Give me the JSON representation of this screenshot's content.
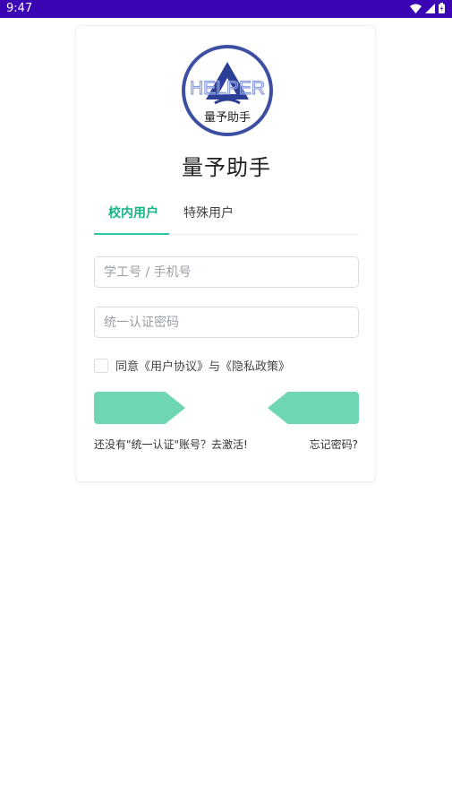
{
  "status_bar": {
    "time": "9:47"
  },
  "app": {
    "title": "量予助手",
    "logo_text_top": "HELPER",
    "logo_text_bottom": "量予助手"
  },
  "tabs": [
    {
      "label": "校内用户",
      "active": true
    },
    {
      "label": "特殊用户",
      "active": false
    }
  ],
  "form": {
    "username_placeholder": "学工号 / 手机号",
    "password_placeholder": "统一认证密码",
    "agreement_text": "同意《用户协议》与《隐私政策》"
  },
  "links": {
    "activate": "还没有\"统一认证\"账号？去激活!",
    "forgot": "忘记密码?"
  },
  "colors": {
    "status_bar": "#3a05b3",
    "accent": "#17b58a",
    "button": "#6ed6b0",
    "logo_ring": "#3c4fa3"
  }
}
